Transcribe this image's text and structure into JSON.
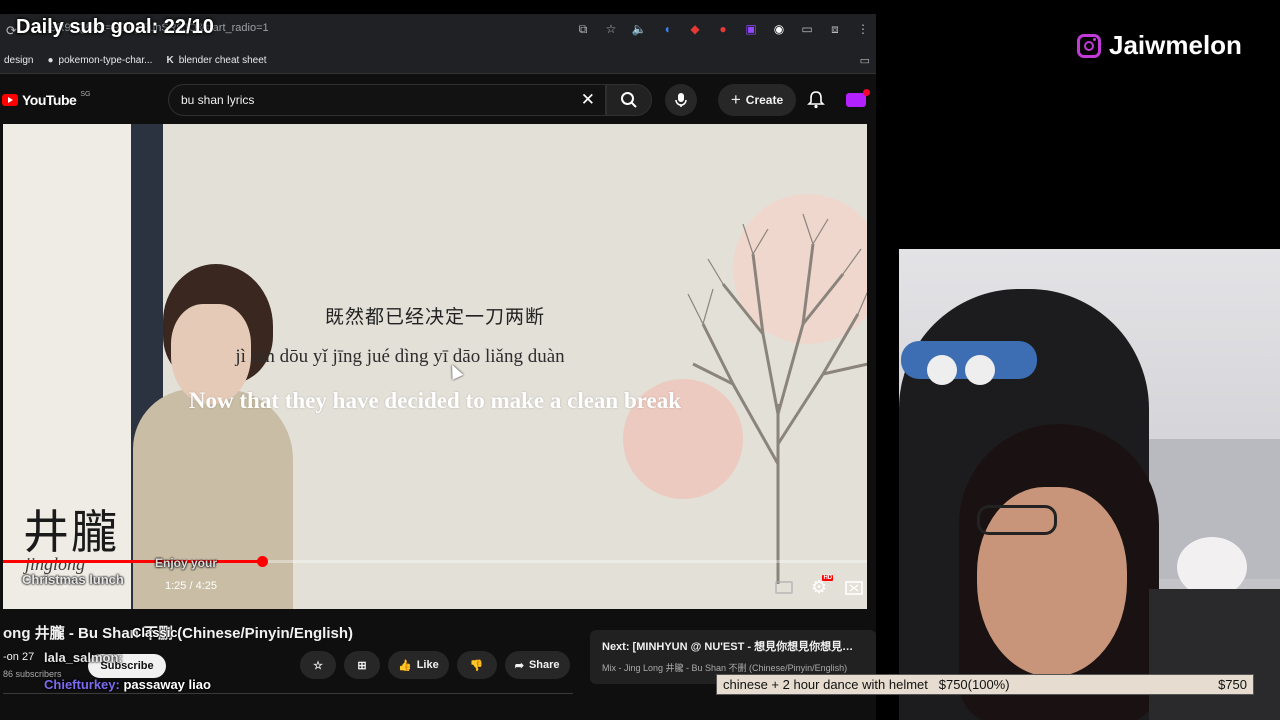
{
  "browser": {
    "url": "...SR9JQ&list=RDDj-EunSR9JQ&start_radio=1",
    "bookmarks": [
      {
        "label": "design",
        "icon": ""
      },
      {
        "label": "pokemon-type-char...",
        "icon": "github-icon"
      },
      {
        "label": "blender cheat sheet",
        "icon": "k-icon"
      }
    ]
  },
  "youtube": {
    "brand": "YouTube",
    "region": "SG",
    "search_value": "bu shan lyrics",
    "create_label": "Create"
  },
  "video": {
    "lyric_cn": "既然都已经决定一刀两断",
    "lyric_pinyin": "jì rán dōu yǐ jīng jué dìng yī dāo liǎng duàn",
    "lyric_en": "Now that they have decided to make a clean break",
    "artist_cn": "井朧",
    "artist_en": "jinglong",
    "time": "1:25 / 4:25",
    "progress": 0.3,
    "title": "ong 井朧 - Bu Shan 不删 (Chinese/Pinyin/English)",
    "channel_line": "-on 27",
    "subscribers": "86 subscribers",
    "subscribe_label": "Subscribe",
    "like_label": "Like",
    "share_label": "Share"
  },
  "next_up": {
    "title": "Next: [MINHYUN @ NU'EST - 想見你想見你想見你(...",
    "subtitle": "Mix - Jing Long 井朧 - Bu Shan 不删 (Chinese/Pinyin/English)"
  },
  "stream": {
    "sub_goal": "Daily sub goal: 22/10",
    "instagram": "Jaiwmelon",
    "goal_text": "chinese + 2 hour dance with helmet",
    "goal_progress": "$750(100%)",
    "goal_total": "$750",
    "chat": [
      {
        "user": "Christmas lunch",
        "message": "Enjoy your",
        "user_color": "#ffffff"
      },
      {
        "user": "",
        "message": "Classic",
        "user_color": "#e05a9a"
      },
      {
        "user": "lala_salmon:",
        "message": "",
        "user_color": "#cfcfcf"
      },
      {
        "user": "Chiefturkey:",
        "message": "passaway liao",
        "user_color": "#7b6cf0"
      }
    ]
  },
  "colors": {
    "youtube_red": "#ff0000",
    "instagram": "#c13bd8",
    "goal_bar_bg": "#e6ddd0"
  }
}
